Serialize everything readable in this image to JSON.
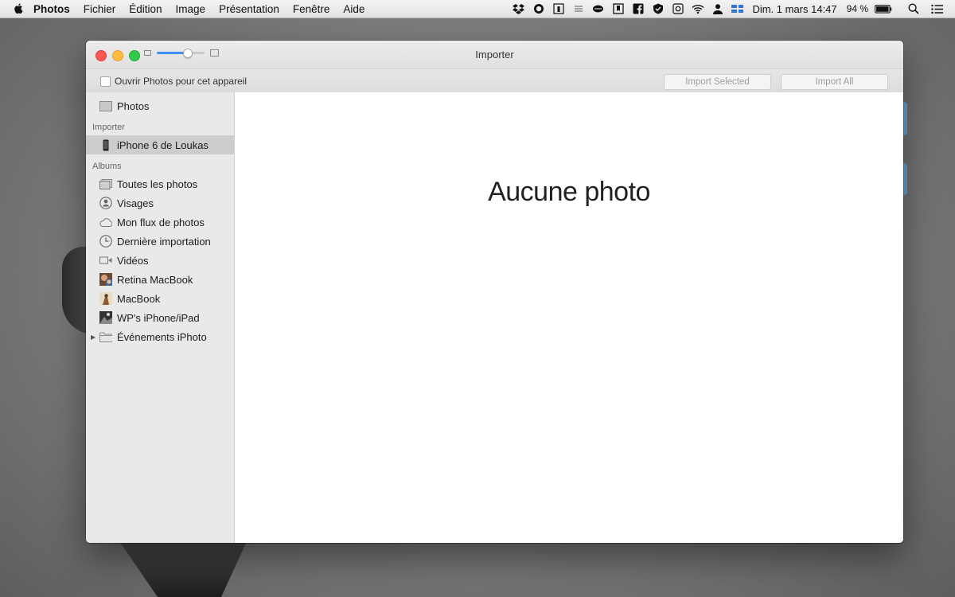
{
  "menubar": {
    "app_name": "Photos",
    "items": [
      "Fichier",
      "Édition",
      "Image",
      "Présentation",
      "Fenêtre",
      "Aide"
    ],
    "datetime": "Dim. 1 mars  14:47",
    "battery": "94 %"
  },
  "window": {
    "title": "Importer",
    "open_photos_label": "Ouvrir Photos pour cet appareil",
    "import_selected_label": "Import Selected",
    "import_all_label": "Import All"
  },
  "sidebar": {
    "photos": "Photos",
    "import_section": "Importer",
    "device": "iPhone 6 de Loukas",
    "albums_section": "Albums",
    "albums": [
      "Toutes les photos",
      "Visages",
      "Mon flux de photos",
      "Dernière importation",
      "Vidéos",
      "Retina MacBook",
      "MacBook",
      "WP's iPhone/iPad",
      "Événements iPhoto"
    ]
  },
  "content": {
    "empty_message": "Aucune photo"
  },
  "colors": {
    "accent": "#3e8ef5",
    "close": "#fc5753",
    "minimize": "#fdbc40",
    "maximize": "#34c84a",
    "selection": "#cdcdcd"
  }
}
